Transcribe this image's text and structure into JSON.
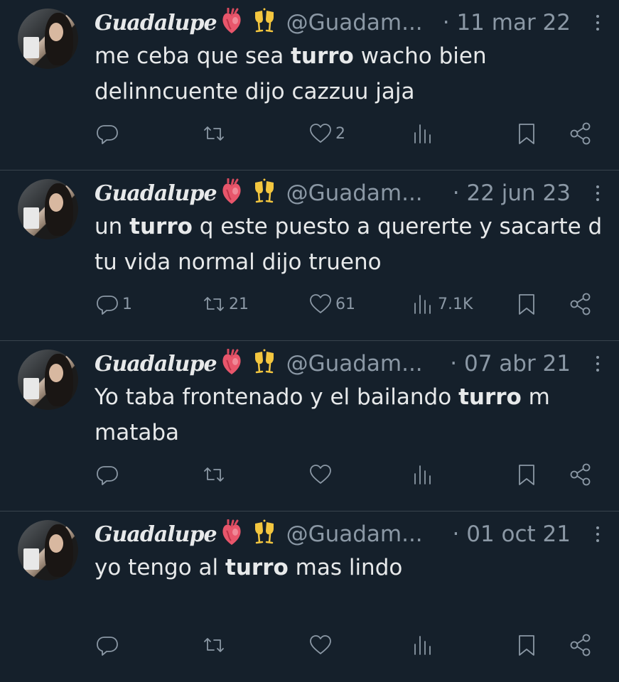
{
  "tweets": [
    {
      "name": "Guadalupe",
      "handle": "@Guadam...",
      "date": "· 11 mar 22",
      "text_before": "me ceba que sea ",
      "highlight": "turro",
      "text_after": " wacho bien delinncuente dijo cazzuu jaja",
      "replies": "",
      "retweets": "",
      "likes": "2",
      "views": ""
    },
    {
      "name": "Guadalupe",
      "handle": "@Guadam...",
      "date": "· 22 jun 23",
      "text_before": "un ",
      "highlight": "turro",
      "text_after": " q este puesto a quererte y sacarte d tu vida normal dijo trueno",
      "replies": "1",
      "retweets": "21",
      "likes": "61",
      "views": "7.1K"
    },
    {
      "name": "Guadalupe",
      "handle": "@Guadam...",
      "date": "· 07 abr 21",
      "text_before": "Yo taba frontenado y el bailando ",
      "highlight": "turro",
      "text_after": " m mataba",
      "replies": "",
      "retweets": "",
      "likes": "",
      "views": ""
    },
    {
      "name": "Guadalupe",
      "handle": "@Guadam...",
      "date": "· 01 oct 21",
      "text_before": "yo tengo al ",
      "highlight": "turro",
      "text_after": " mas lindo",
      "replies": "",
      "retweets": "",
      "likes": "",
      "views": ""
    }
  ],
  "icons": {
    "reply": "speech-bubble-icon",
    "retweet": "retweet-icon",
    "like": "heart-icon",
    "views": "bar-chart-icon",
    "bookmark": "bookmark-icon",
    "share": "share-icon",
    "name_emoji_1": "anatomical-heart-emoji",
    "name_emoji_2": "clinking-glasses-emoji"
  },
  "colors": {
    "background": "#15202b",
    "text": "#e7e9ea",
    "secondary": "#8b98a5",
    "divider": "#38444d"
  }
}
